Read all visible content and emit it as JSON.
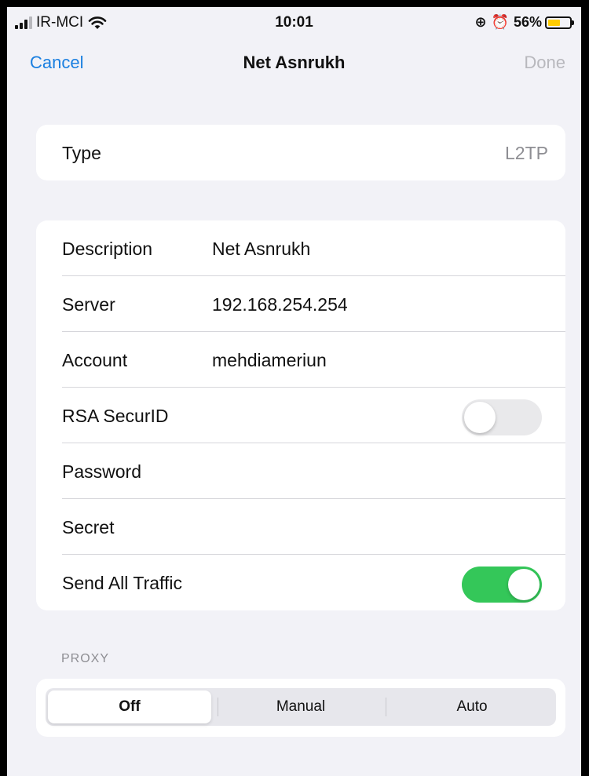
{
  "status_bar": {
    "carrier": "IR-MCI",
    "time": "10:01",
    "battery": "56%",
    "battery_level": 0.56,
    "battery_color": "#ffcc00"
  },
  "nav": {
    "cancel": "Cancel",
    "title": "Net Asnrukh",
    "done": "Done"
  },
  "type_section": {
    "label": "Type",
    "value": "L2TP"
  },
  "fields": {
    "description": {
      "label": "Description",
      "value": "Net Asnrukh"
    },
    "server": {
      "label": "Server",
      "value": "192.168.254.254"
    },
    "account": {
      "label": "Account",
      "value": "mehdiameriun"
    },
    "rsa": {
      "label": "RSA SecurID",
      "on": false
    },
    "password": {
      "label": "Password",
      "value": ""
    },
    "secret": {
      "label": "Secret",
      "value": ""
    },
    "send_all": {
      "label": "Send All Traffic",
      "on": true
    }
  },
  "proxy": {
    "header": "PROXY",
    "options": [
      "Off",
      "Manual",
      "Auto"
    ],
    "selected": "Off"
  },
  "colors": {
    "accent": "#1a7fe0",
    "toggle_on": "#34c759",
    "secondary_text": "#8e8e93"
  }
}
